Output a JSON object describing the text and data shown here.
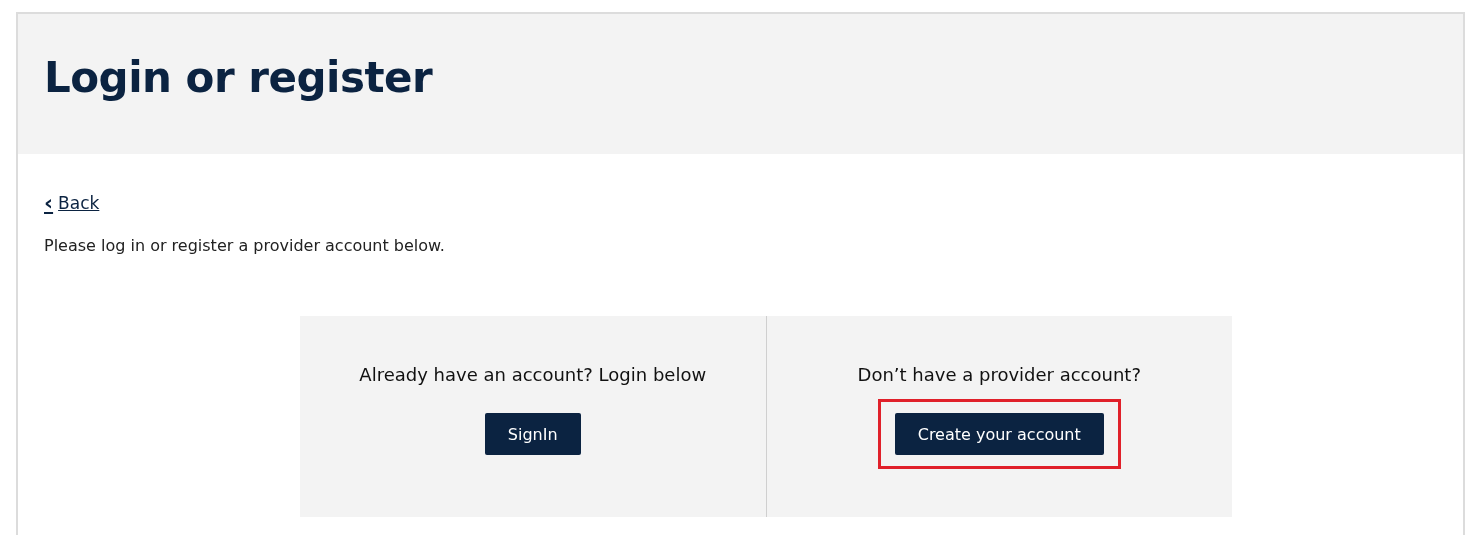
{
  "page": {
    "title": "Login or register"
  },
  "back_link": {
    "icon": "‹",
    "label": "Back"
  },
  "intro": "Please log in or register a provider account below.",
  "panels": [
    {
      "heading": "Already have an account? Login below",
      "button": {
        "label": "SignIn",
        "highlighted": false
      }
    },
    {
      "heading": "Don’t have a provider account?",
      "button": {
        "label": "Create your account",
        "highlighted": true
      }
    }
  ]
}
